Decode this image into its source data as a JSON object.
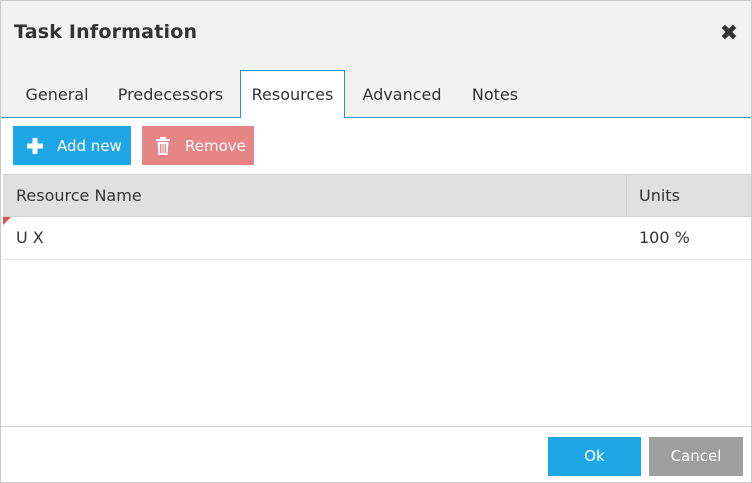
{
  "dialog": {
    "title": "Task Information",
    "close_icon": "close-icon"
  },
  "tabs": [
    {
      "label": "General",
      "active": false
    },
    {
      "label": "Predecessors",
      "active": false
    },
    {
      "label": "Resources",
      "active": true
    },
    {
      "label": "Advanced",
      "active": false
    },
    {
      "label": "Notes",
      "active": false
    }
  ],
  "toolbar": {
    "add_label": "Add new",
    "add_icon": "plus-icon",
    "remove_label": "Remove",
    "remove_icon": "trash-icon"
  },
  "grid": {
    "columns": [
      "Resource Name",
      "Units"
    ],
    "rows": [
      {
        "name": "U X",
        "units": "100 %",
        "dirty": true
      }
    ]
  },
  "footer": {
    "ok_label": "Ok",
    "cancel_label": "Cancel"
  },
  "colors": {
    "accent": "#1ea7e4",
    "remove": "#e58585",
    "cancel": "#9e9e9e",
    "dirty_flag": "#d9534f"
  }
}
